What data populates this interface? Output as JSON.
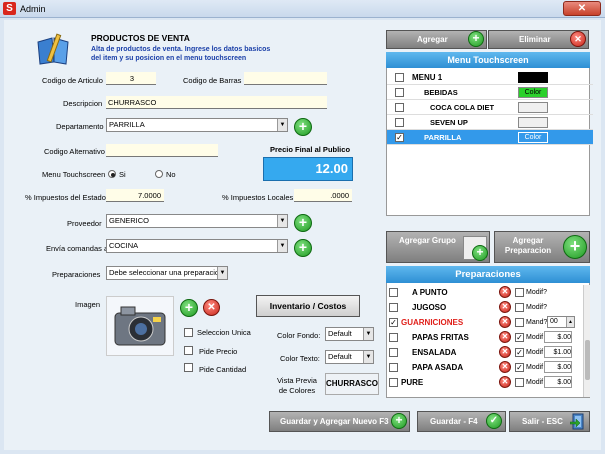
{
  "window": {
    "title": "Admin",
    "app_icon_letter": "S",
    "close_glyph": "✕"
  },
  "header": {
    "title": "PRODUCTOS DE VENTA",
    "subtitle": "Alta de productos de venta. Ingrese los datos basicos del item y su posicion en el menu touchscreen"
  },
  "form": {
    "codigo_articulo_label": "Codigo de Articulo",
    "codigo_articulo_value": "3",
    "codigo_barras_label": "Codigo de Barras",
    "codigo_barras_value": "",
    "descripcion_label": "Descripcion",
    "descripcion_value": "CHURRASCO",
    "departamento_label": "Departamento",
    "departamento_value": "PARRILLA",
    "codigo_alternativo_label": "Codigo Alternativo",
    "codigo_alternativo_value": "",
    "precio_final_label": "Precio Final al Publico",
    "precio_final_value": "12.00",
    "menu_touch_label": "Menu Touchscreen",
    "radio_si": "Si",
    "radio_no": "No",
    "imp_estado_label": "% Impuestos del Estado",
    "imp_estado_value": "7.0000",
    "imp_locales_label": "% Impuestos Locales",
    "imp_locales_value": ".0000",
    "proveedor_label": "Proveedor",
    "proveedor_value": "GENERICO",
    "envia_label": "Envía comandas a",
    "envia_value": "COCINA",
    "preparaciones_label": "Preparaciones",
    "preparaciones_value": "Debe seleccionar una preparacion",
    "imagen_label": "Imagen",
    "inventario_btn": "Inventario / Costos",
    "seleccion_unica": "Seleccion Unica",
    "pide_precio": "Pide Precio",
    "pide_cantidad": "Pide Cantidad",
    "color_fondo_label": "Color Fondo:",
    "color_fondo_value": "Default",
    "color_texto_label": "Color Texto:",
    "color_texto_value": "Default",
    "vista_previa_label": "Vista Previa de Colores",
    "vista_previa_value": "CHURRASCO"
  },
  "right": {
    "agregar_btn": "Agregar",
    "eliminar_btn": "Eliminar",
    "menu_header": "Menu Touchscreen",
    "menu_items": [
      {
        "label": "MENU 1",
        "checked": false,
        "color_btn": ""
      },
      {
        "label": "BEBIDAS",
        "checked": false,
        "color_btn": "Color"
      },
      {
        "label": "COCA COLA DIET",
        "checked": false,
        "color_btn": ""
      },
      {
        "label": "SEVEN UP",
        "checked": false,
        "color_btn": ""
      },
      {
        "label": "PARRILLA",
        "checked": true,
        "color_btn": "Color"
      }
    ],
    "agregar_grupo_btn": "Agregar Grupo",
    "agregar_prep_btn": "Agregar Preparacion",
    "prep_header": "Preparaciones",
    "prep_items": [
      {
        "label": "A PUNTO",
        "opt": "Modif?",
        "checked": false,
        "price": ""
      },
      {
        "label": "JUGOSO",
        "opt": "Modif?",
        "checked": false,
        "price": ""
      },
      {
        "label": "GUARNICIONES",
        "opt": "Mand?",
        "checked": true,
        "price": "00"
      },
      {
        "label": "PAPAS FRITAS",
        "opt": "Modif",
        "checked": false,
        "price": "$.00"
      },
      {
        "label": "ENSALADA",
        "opt": "Modif",
        "checked": false,
        "price": "$1.00"
      },
      {
        "label": "PAPA ASADA",
        "opt": "Modif",
        "checked": false,
        "price": "$.00"
      },
      {
        "label": "PURE",
        "opt": "Modif",
        "checked": false,
        "price": "$.00"
      }
    ]
  },
  "footer": {
    "guardar_nuevo": "Guardar y Agregar Nuevo F3",
    "guardar": "Guardar - F4",
    "salir": "Salir - ESC"
  },
  "colors": {
    "accent_blue": "#2e8fd4",
    "price_bg": "#35a9ef",
    "guarniciones_red": "#e0201a",
    "bebidas_green": "#2ad02a"
  }
}
